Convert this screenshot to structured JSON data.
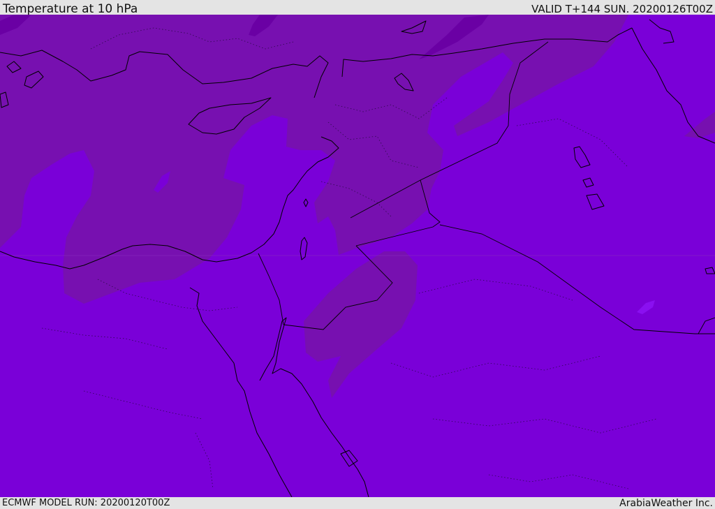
{
  "header": {
    "title": "Temperature at 10 hPa",
    "valid": "VALID T+144 SUN. 20200126T00Z"
  },
  "footer": {
    "model_run": "ECMWF MODEL RUN: 20200120T00Z",
    "credit": "ArabiaWeather Inc."
  },
  "colors": {
    "background_field": "#7a00d8",
    "warm_field": "#7710b0",
    "cold_core": "#6a00a4",
    "coastline": "#000000"
  }
}
